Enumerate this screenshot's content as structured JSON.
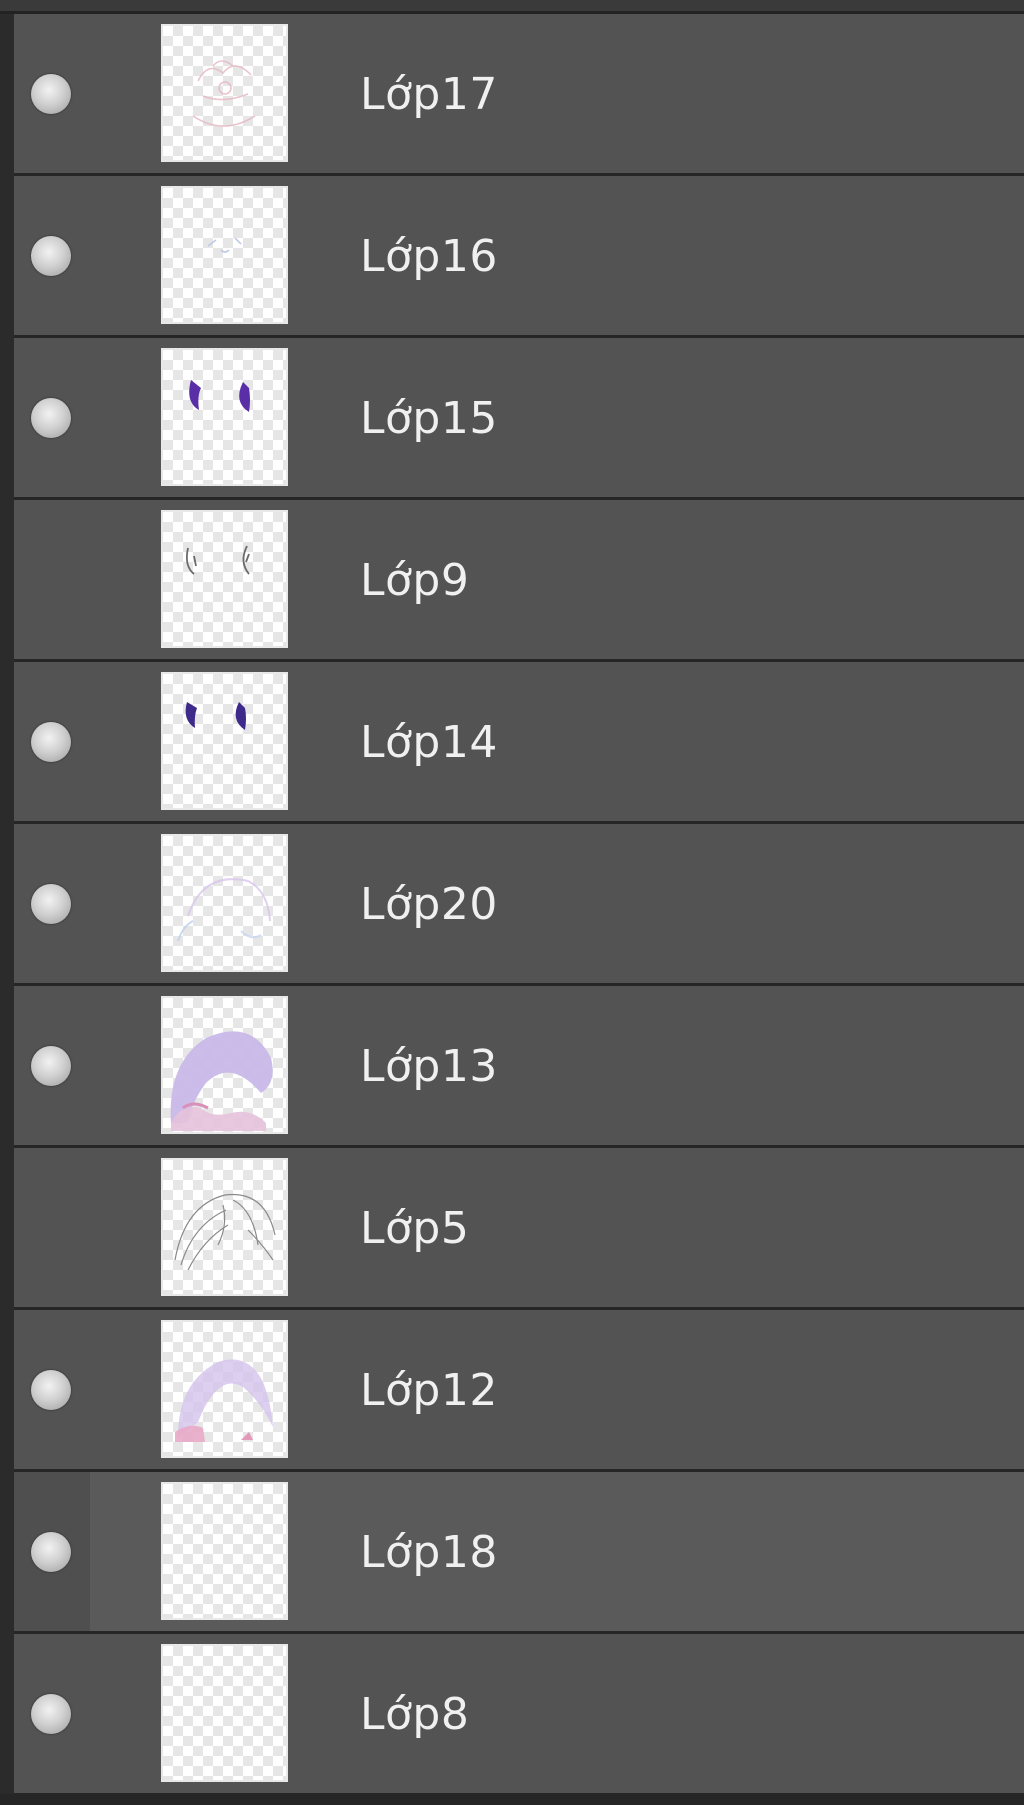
{
  "layers_panel": {
    "layers": [
      {
        "name": "Lớp17",
        "visible": true,
        "selected": false,
        "thumbnail": "faint-pink-sketch"
      },
      {
        "name": "Lớp16",
        "visible": true,
        "selected": false,
        "thumbnail": "faint-blue-marks"
      },
      {
        "name": "Lớp15",
        "visible": true,
        "selected": false,
        "thumbnail": "purple-horns"
      },
      {
        "name": "Lớp9",
        "visible": false,
        "selected": false,
        "thumbnail": "gray-horn-outline"
      },
      {
        "name": "Lớp14",
        "visible": true,
        "selected": false,
        "thumbnail": "dark-purple-horns"
      },
      {
        "name": "Lớp20",
        "visible": true,
        "selected": false,
        "thumbnail": "faint-hair-outline"
      },
      {
        "name": "Lớp13",
        "visible": true,
        "selected": false,
        "thumbnail": "lavender-hair-fill"
      },
      {
        "name": "Lớp5",
        "visible": false,
        "selected": false,
        "thumbnail": "gray-hair-lineart"
      },
      {
        "name": "Lớp12",
        "visible": true,
        "selected": false,
        "thumbnail": "pink-hair-shading"
      },
      {
        "name": "Lớp18",
        "visible": true,
        "selected": true,
        "thumbnail": "empty"
      },
      {
        "name": "Lớp8",
        "visible": true,
        "selected": false,
        "thumbnail": "empty"
      }
    ]
  },
  "colors": {
    "row_bg": "#535353",
    "row_selected_bg": "#5a5a5a",
    "separator": "#262626",
    "text": "#f0f0f0",
    "horn_purple": "#5a2ea6",
    "horn_dark_purple": "#3d2a8a"
  }
}
